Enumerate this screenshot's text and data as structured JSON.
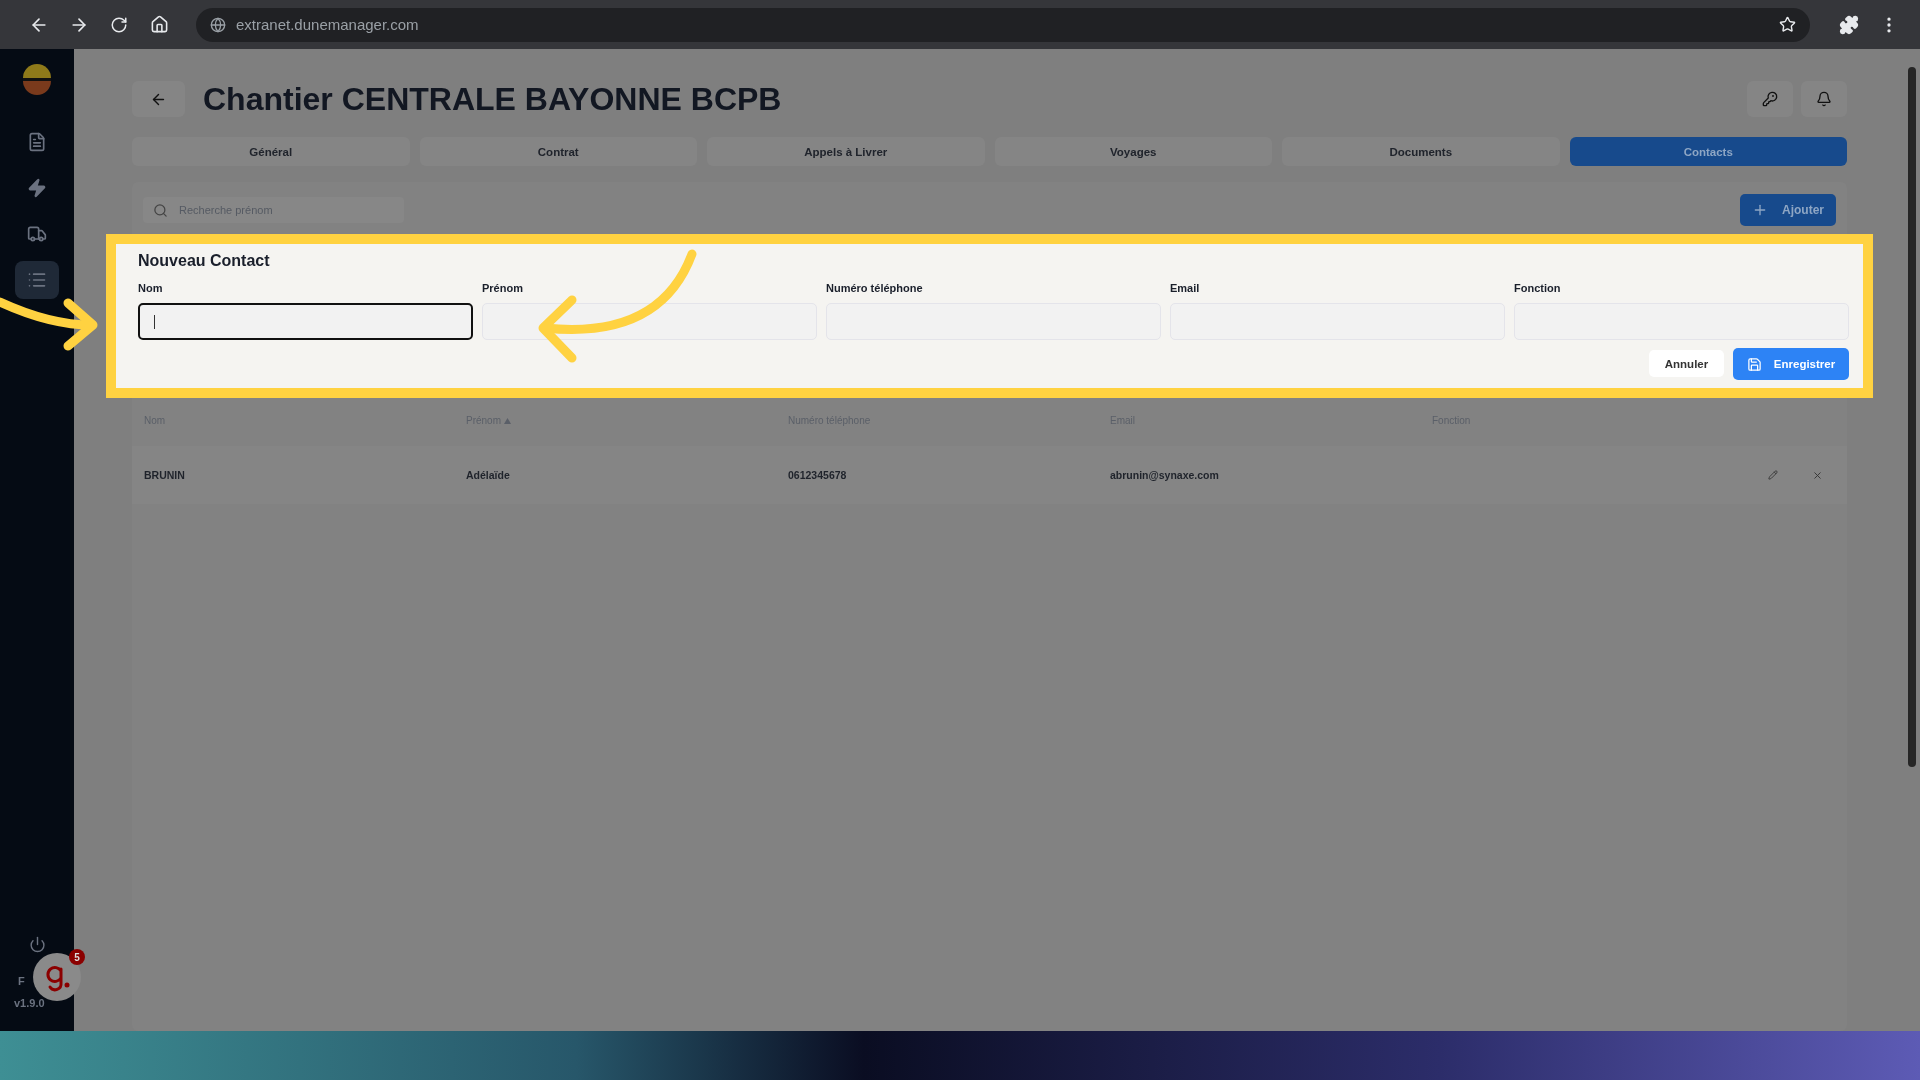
{
  "browser": {
    "url": "extranet.dunemanager.com"
  },
  "sidebar": {
    "items": [
      {
        "kind": "document",
        "selected": false
      },
      {
        "kind": "bolt",
        "selected": false
      },
      {
        "kind": "truck",
        "selected": false
      },
      {
        "kind": "list",
        "selected": true
      }
    ],
    "language": "F",
    "version": "v1.9.0"
  },
  "help_badge": {
    "count": "5"
  },
  "header": {
    "title": "Chantier CENTRALE BAYONNE BCPB"
  },
  "tabs": [
    {
      "label": "Général",
      "selected": false
    },
    {
      "label": "Contrat",
      "selected": false
    },
    {
      "label": "Appels à Livrer",
      "selected": false
    },
    {
      "label": "Voyages",
      "selected": false
    },
    {
      "label": "Documents",
      "selected": false
    },
    {
      "label": "Contacts",
      "selected": true
    }
  ],
  "search": {
    "placeholder": "Recherche prénom"
  },
  "add_button": "Ajouter",
  "form": {
    "title": "Nouveau Contact",
    "fields": [
      {
        "label": "Nom",
        "focused": true
      },
      {
        "label": "Prénom",
        "focused": false
      },
      {
        "label": "Numéro téléphone",
        "focused": false
      },
      {
        "label": "Email",
        "focused": false
      },
      {
        "label": "Fonction",
        "focused": false
      }
    ],
    "cancel": "Annuler",
    "save": "Enregistrer"
  },
  "table": {
    "columns": [
      {
        "label": "Nom",
        "sorted": false
      },
      {
        "label": "Prénom",
        "sorted": true
      },
      {
        "label": "Numéro téléphone",
        "sorted": false
      },
      {
        "label": "Email",
        "sorted": false
      },
      {
        "label": "Fonction",
        "sorted": false
      }
    ],
    "rows": [
      {
        "cells": [
          "BRUNIN",
          "Adélaïde",
          "0612345678",
          "abrunin@synaxe.com"
        ]
      }
    ]
  }
}
